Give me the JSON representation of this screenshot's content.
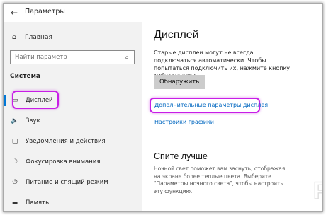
{
  "window": {
    "title": "Параметры",
    "back_icon": "←",
    "minimize_icon": "—",
    "maximize_icon": "☐",
    "close_icon": "✕"
  },
  "sidebar": {
    "home_label": "Главная",
    "home_icon": "⌂",
    "search_placeholder": "Найти параметр",
    "search_icon": "⌕",
    "section_title": "Система",
    "items": [
      {
        "label": "Дисплей",
        "icon": "▭",
        "active": true
      },
      {
        "label": "Звук",
        "icon": "🔈"
      },
      {
        "label": "Уведомления и действия",
        "icon": "▢"
      },
      {
        "label": "Фокусировка внимания",
        "icon": "☽"
      },
      {
        "label": "Питание и спящий режим",
        "icon": "⏻"
      },
      {
        "label": "Память",
        "icon": "▬"
      }
    ]
  },
  "main": {
    "title": "Дисплей",
    "description": "Старые дисплеи могут не всегда подключаться автоматически. Чтобы попытаться подключить их, нажмите кнопку \"Обнаружить\".",
    "detect_button": "Обнаружить",
    "link_advanced": "Дополнительные параметры дисплея",
    "link_graphics": "Настройки графики",
    "sleep_title": "Спите лучше",
    "sleep_description": "Ночной свет поможет вам заснуть, отображая на экране более теплые цвета. Выберите \"Параметры ночного света\", чтобы настроить эту функцию."
  },
  "watermark": {
    "text": "Posuda.Ru"
  },
  "colors": {
    "accent": "#0078d7",
    "link": "#0067c0",
    "highlight": "#c81ee6",
    "sidebar_bg": "#f2f2f2",
    "button_bg": "#cccccc"
  }
}
